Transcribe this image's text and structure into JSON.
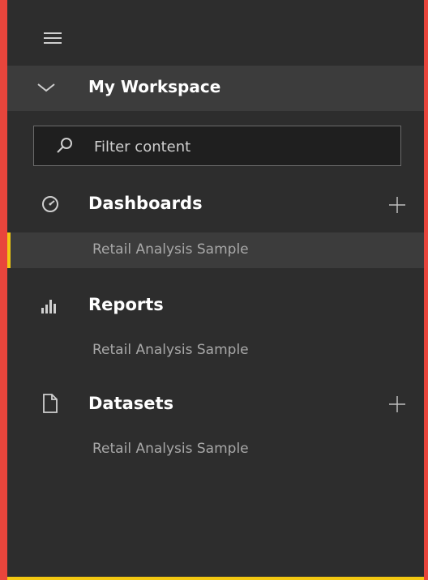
{
  "workspace": {
    "title": "My Workspace"
  },
  "filter": {
    "placeholder": "Filter content"
  },
  "sections": {
    "dashboards": {
      "title": "Dashboards",
      "item": "Retail Analysis Sample"
    },
    "reports": {
      "title": "Reports",
      "item": "Retail Analysis Sample"
    },
    "datasets": {
      "title": "Datasets",
      "item": "Retail Analysis Sample"
    }
  },
  "colors": {
    "accent": "#f2c811",
    "frame": "#e8453c",
    "panel": "#2d2d2d"
  },
  "icons": [
    "menu-icon",
    "chevron-down-icon",
    "search-icon",
    "dashboard-gauge-icon",
    "reports-bar-chart-icon",
    "dataset-document-icon",
    "add-icon"
  ]
}
